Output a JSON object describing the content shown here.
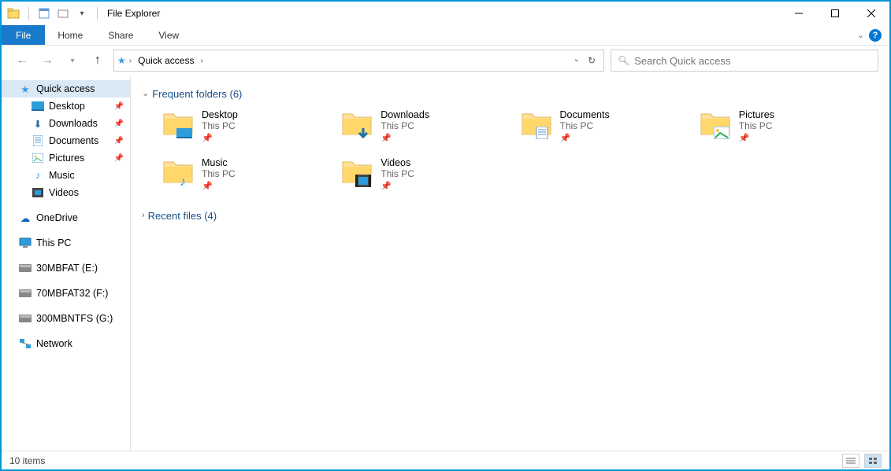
{
  "window": {
    "title": "File Explorer"
  },
  "ribbon": {
    "file": "File",
    "tabs": [
      "Home",
      "Share",
      "View"
    ]
  },
  "address": {
    "location": "Quick access"
  },
  "search": {
    "placeholder": "Search Quick access"
  },
  "navpane": {
    "quick_access": "Quick access",
    "quick_items": [
      {
        "label": "Desktop",
        "pinned": true,
        "icon": "desktop"
      },
      {
        "label": "Downloads",
        "pinned": true,
        "icon": "download"
      },
      {
        "label": "Documents",
        "pinned": true,
        "icon": "document"
      },
      {
        "label": "Pictures",
        "pinned": true,
        "icon": "picture"
      },
      {
        "label": "Music",
        "pinned": false,
        "icon": "music"
      },
      {
        "label": "Videos",
        "pinned": false,
        "icon": "video"
      }
    ],
    "onedrive": "OneDrive",
    "this_pc": "This PC",
    "drives": [
      {
        "label": "30MBFAT (E:)"
      },
      {
        "label": "70MBFAT32 (F:)"
      },
      {
        "label": "300MBNTFS (G:)"
      }
    ],
    "network": "Network"
  },
  "sections": {
    "frequent": {
      "label": "Frequent folders (6)"
    },
    "recent": {
      "label": "Recent files (4)"
    }
  },
  "folders": [
    {
      "name": "Desktop",
      "location": "This PC",
      "overlay": "desktop"
    },
    {
      "name": "Downloads",
      "location": "This PC",
      "overlay": "download"
    },
    {
      "name": "Documents",
      "location": "This PC",
      "overlay": "document"
    },
    {
      "name": "Pictures",
      "location": "This PC",
      "overlay": "picture"
    },
    {
      "name": "Music",
      "location": "This PC",
      "overlay": "music"
    },
    {
      "name": "Videos",
      "location": "This PC",
      "overlay": "video"
    }
  ],
  "status": {
    "items": "10 items"
  }
}
